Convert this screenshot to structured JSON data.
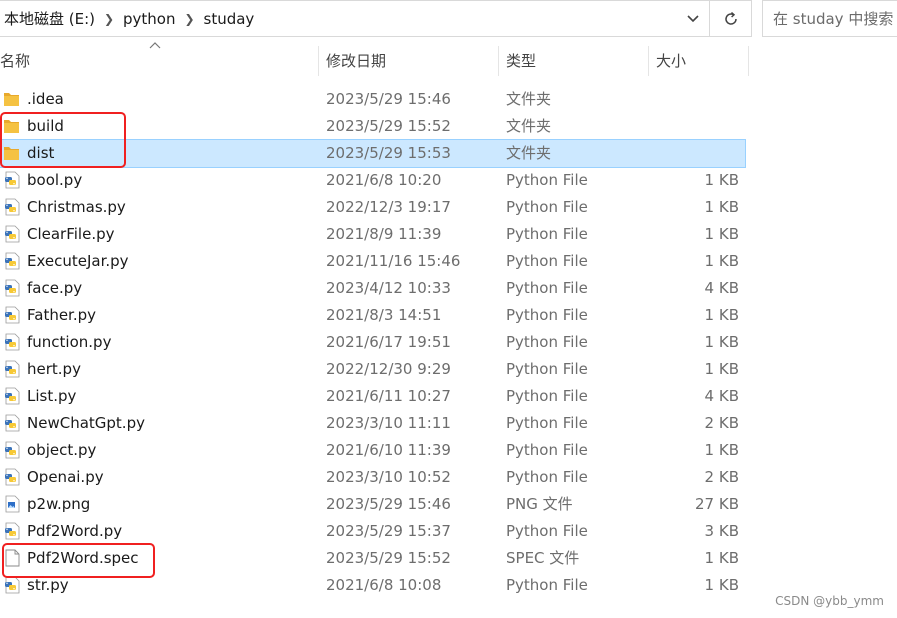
{
  "address": {
    "crumbs": [
      "本地磁盘 (E:)",
      "python",
      "studay"
    ]
  },
  "search": {
    "placeholder": "在 studay 中搜索"
  },
  "columns": {
    "name": "名称",
    "date": "修改日期",
    "type": "类型",
    "size": "大小"
  },
  "files": [
    {
      "name": ".idea",
      "date": "2023/5/29 15:46",
      "type": "文件夹",
      "size": "",
      "icon": "folder-icon"
    },
    {
      "name": "build",
      "date": "2023/5/29 15:52",
      "type": "文件夹",
      "size": "",
      "icon": "folder-icon"
    },
    {
      "name": "dist",
      "date": "2023/5/29 15:53",
      "type": "文件夹",
      "size": "",
      "icon": "folder-icon",
      "selected": true
    },
    {
      "name": "bool.py",
      "date": "2021/6/8 10:20",
      "type": "Python File",
      "size": "1 KB",
      "icon": "python-file-icon"
    },
    {
      "name": "Christmas.py",
      "date": "2022/12/3 19:17",
      "type": "Python File",
      "size": "1 KB",
      "icon": "python-file-icon"
    },
    {
      "name": "ClearFile.py",
      "date": "2021/8/9 11:39",
      "type": "Python File",
      "size": "1 KB",
      "icon": "python-file-icon"
    },
    {
      "name": "ExecuteJar.py",
      "date": "2021/11/16 15:46",
      "type": "Python File",
      "size": "1 KB",
      "icon": "python-file-icon"
    },
    {
      "name": "face.py",
      "date": "2023/4/12 10:33",
      "type": "Python File",
      "size": "4 KB",
      "icon": "python-file-icon"
    },
    {
      "name": "Father.py",
      "date": "2021/8/3 14:51",
      "type": "Python File",
      "size": "1 KB",
      "icon": "python-file-icon"
    },
    {
      "name": "function.py",
      "date": "2021/6/17 19:51",
      "type": "Python File",
      "size": "1 KB",
      "icon": "python-file-icon"
    },
    {
      "name": "hert.py",
      "date": "2022/12/30 9:29",
      "type": "Python File",
      "size": "1 KB",
      "icon": "python-file-icon"
    },
    {
      "name": "List.py",
      "date": "2021/6/11 10:27",
      "type": "Python File",
      "size": "4 KB",
      "icon": "python-file-icon"
    },
    {
      "name": "NewChatGpt.py",
      "date": "2023/3/10 11:11",
      "type": "Python File",
      "size": "2 KB",
      "icon": "python-file-icon"
    },
    {
      "name": "object.py",
      "date": "2021/6/10 11:39",
      "type": "Python File",
      "size": "1 KB",
      "icon": "python-file-icon"
    },
    {
      "name": "Openai.py",
      "date": "2023/3/10 10:52",
      "type": "Python File",
      "size": "2 KB",
      "icon": "python-file-icon"
    },
    {
      "name": "p2w.png",
      "date": "2023/5/29 15:46",
      "type": "PNG 文件",
      "size": "27 KB",
      "icon": "image-file-icon"
    },
    {
      "name": "Pdf2Word.py",
      "date": "2023/5/29 15:37",
      "type": "Python File",
      "size": "3 KB",
      "icon": "python-file-icon"
    },
    {
      "name": "Pdf2Word.spec",
      "date": "2023/5/29 15:52",
      "type": "SPEC 文件",
      "size": "1 KB",
      "icon": "blank-file-icon"
    },
    {
      "name": "str.py",
      "date": "2021/6/8 10:08",
      "type": "Python File",
      "size": "1 KB",
      "icon": "python-file-icon"
    }
  ],
  "colors": {
    "selected_bg": "#cce8ff",
    "highlight_box": "#f02020",
    "folder": "#f5c242"
  },
  "watermark": "CSDN @ybb_ymm"
}
